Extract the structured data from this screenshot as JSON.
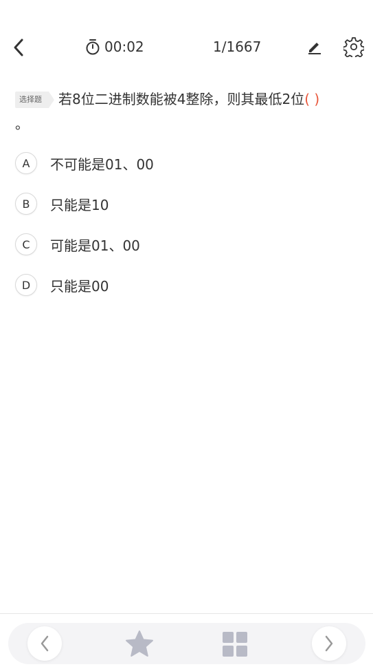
{
  "header": {
    "back_icon": "chevron-left-icon",
    "timer_icon": "stopwatch-icon",
    "timer": "00:02",
    "counter": "1/1667",
    "edit_icon": "pencil-icon",
    "settings_icon": "gear-icon"
  },
  "question": {
    "type_badge": "选择题",
    "text": "若8位二进制数能被4整除，则其最低2位",
    "blank": "( )",
    "ending": "。"
  },
  "options": [
    {
      "letter": "A",
      "text": "不可能是01、00"
    },
    {
      "letter": "B",
      "text": "只能是10"
    },
    {
      "letter": "C",
      "text": "可能是01、00"
    },
    {
      "letter": "D",
      "text": "只能是00"
    }
  ],
  "footer": {
    "prev_icon": "chevron-left-icon",
    "favorite_icon": "star-icon",
    "grid_icon": "grid-icon",
    "next_icon": "chevron-right-icon"
  },
  "colors": {
    "accent_blank": "#e8563a",
    "icon_gray": "#b8bac6"
  }
}
